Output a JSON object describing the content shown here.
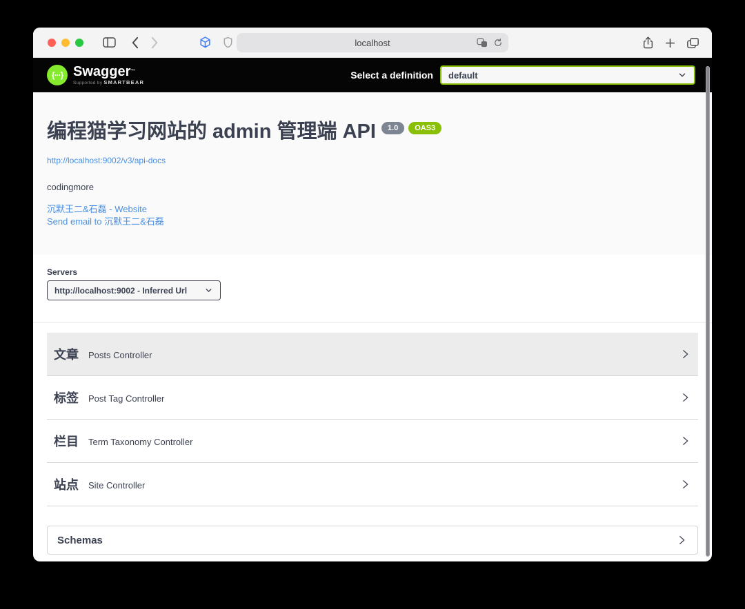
{
  "browser": {
    "url_text": "localhost",
    "traffic_lights": [
      "close",
      "minimize",
      "zoom"
    ],
    "icons": {
      "sidebar": "sidebar-toggle",
      "back": "chevron-left",
      "forward": "chevron-right",
      "extension_cube": "blue-cube-extension",
      "extension_shield": "shield-extension",
      "translate": "translate",
      "reload": "reload",
      "share": "share",
      "new_tab": "plus",
      "tab_overview": "tabs"
    }
  },
  "topbar": {
    "brand": "Swagger",
    "brand_tm": "™",
    "brand_supported_by": "Supported by",
    "brand_company": "SMARTBEAR",
    "logo_glyph": "{···}",
    "definition_label": "Select a definition",
    "definition_value": "default"
  },
  "info": {
    "title": "编程猫学习网站的 admin 管理端 API",
    "version_badge": "1.0",
    "oas_badge": "OAS3",
    "api_docs_link": "http://localhost:9002/v3/api-docs",
    "description": "codingmore",
    "website_link": "沉默王二&石磊 - Website",
    "email_link": "Send email to 沉默王二&石磊"
  },
  "servers": {
    "label": "Servers",
    "selected": "http://localhost:9002 - Inferred Url"
  },
  "tags": [
    {
      "name": "文章",
      "description": "Posts Controller"
    },
    {
      "name": "标签",
      "description": "Post Tag Controller"
    },
    {
      "name": "栏目",
      "description": "Term Taxonomy Controller"
    },
    {
      "name": "站点",
      "description": "Site Controller"
    }
  ],
  "schemas": {
    "label": "Schemas"
  },
  "colors": {
    "brand_green": "#85ea2d",
    "oas_badge_green": "#89bf04",
    "version_badge_gray": "#7d8492",
    "link_blue": "#4990e2",
    "text_dark": "#3b4151",
    "topbar_black": "#050505",
    "info_bg": "#fafafa",
    "row_hover_bg": "#ececec"
  }
}
